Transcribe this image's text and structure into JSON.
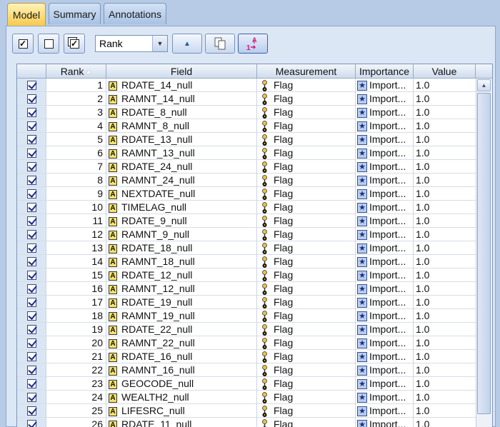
{
  "tabs": [
    {
      "label": "Model",
      "active": true
    },
    {
      "label": "Summary",
      "active": false
    },
    {
      "label": "Annotations",
      "active": false
    }
  ],
  "toolbar": {
    "sort_select": "Rank",
    "check_all_icon": "checkbox-checked-icon",
    "uncheck_all_icon": "checkbox-empty-icon",
    "toggle_icon": "checkbox-toggle-icon",
    "sort_asc_icon": "triangle-up-icon",
    "copy_icon": "copy-icon",
    "sort_order_icon": "sort-az-icon"
  },
  "table": {
    "headers": [
      "Rank",
      "Field",
      "Measurement",
      "Importance",
      "Value"
    ],
    "rows": [
      {
        "rank": "1",
        "field": "RDATE_14_null",
        "measurement": "Flag",
        "importance": "Import...",
        "value": "1.0"
      },
      {
        "rank": "2",
        "field": "RAMNT_14_null",
        "measurement": "Flag",
        "importance": "Import...",
        "value": "1.0"
      },
      {
        "rank": "3",
        "field": "RDATE_8_null",
        "measurement": "Flag",
        "importance": "Import...",
        "value": "1.0"
      },
      {
        "rank": "4",
        "field": "RAMNT_8_null",
        "measurement": "Flag",
        "importance": "Import...",
        "value": "1.0"
      },
      {
        "rank": "5",
        "field": "RDATE_13_null",
        "measurement": "Flag",
        "importance": "Import...",
        "value": "1.0"
      },
      {
        "rank": "6",
        "field": "RAMNT_13_null",
        "measurement": "Flag",
        "importance": "Import...",
        "value": "1.0"
      },
      {
        "rank": "7",
        "field": "RDATE_24_null",
        "measurement": "Flag",
        "importance": "Import...",
        "value": "1.0"
      },
      {
        "rank": "8",
        "field": "RAMNT_24_null",
        "measurement": "Flag",
        "importance": "Import...",
        "value": "1.0"
      },
      {
        "rank": "9",
        "field": "NEXTDATE_null",
        "measurement": "Flag",
        "importance": "Import...",
        "value": "1.0"
      },
      {
        "rank": "10",
        "field": "TIMELAG_null",
        "measurement": "Flag",
        "importance": "Import...",
        "value": "1.0"
      },
      {
        "rank": "11",
        "field": "RDATE_9_null",
        "measurement": "Flag",
        "importance": "Import...",
        "value": "1.0"
      },
      {
        "rank": "12",
        "field": "RAMNT_9_null",
        "measurement": "Flag",
        "importance": "Import...",
        "value": "1.0"
      },
      {
        "rank": "13",
        "field": "RDATE_18_null",
        "measurement": "Flag",
        "importance": "Import...",
        "value": "1.0"
      },
      {
        "rank": "14",
        "field": "RAMNT_18_null",
        "measurement": "Flag",
        "importance": "Import...",
        "value": "1.0"
      },
      {
        "rank": "15",
        "field": "RDATE_12_null",
        "measurement": "Flag",
        "importance": "Import...",
        "value": "1.0"
      },
      {
        "rank": "16",
        "field": "RAMNT_12_null",
        "measurement": "Flag",
        "importance": "Import...",
        "value": "1.0"
      },
      {
        "rank": "17",
        "field": "RDATE_19_null",
        "measurement": "Flag",
        "importance": "Import...",
        "value": "1.0"
      },
      {
        "rank": "18",
        "field": "RAMNT_19_null",
        "measurement": "Flag",
        "importance": "Import...",
        "value": "1.0"
      },
      {
        "rank": "19",
        "field": "RDATE_22_null",
        "measurement": "Flag",
        "importance": "Import...",
        "value": "1.0"
      },
      {
        "rank": "20",
        "field": "RAMNT_22_null",
        "measurement": "Flag",
        "importance": "Import...",
        "value": "1.0"
      },
      {
        "rank": "21",
        "field": "RDATE_16_null",
        "measurement": "Flag",
        "importance": "Import...",
        "value": "1.0"
      },
      {
        "rank": "22",
        "field": "RAMNT_16_null",
        "measurement": "Flag",
        "importance": "Import...",
        "value": "1.0"
      },
      {
        "rank": "23",
        "field": "GEOCODE_null",
        "measurement": "Flag",
        "importance": "Import...",
        "value": "1.0"
      },
      {
        "rank": "24",
        "field": "WEALTH2_null",
        "measurement": "Flag",
        "importance": "Import...",
        "value": "1.0"
      },
      {
        "rank": "25",
        "field": "LIFESRC_null",
        "measurement": "Flag",
        "importance": "Import...",
        "value": "1.0"
      },
      {
        "rank": "26",
        "field": "RDATE_11_null",
        "measurement": "Flag",
        "importance": "Import...",
        "value": "1.0"
      }
    ]
  },
  "colors": {
    "active_tab": "#f7c84a",
    "panel": "#dce7f5",
    "check": "#1c2a8a"
  }
}
